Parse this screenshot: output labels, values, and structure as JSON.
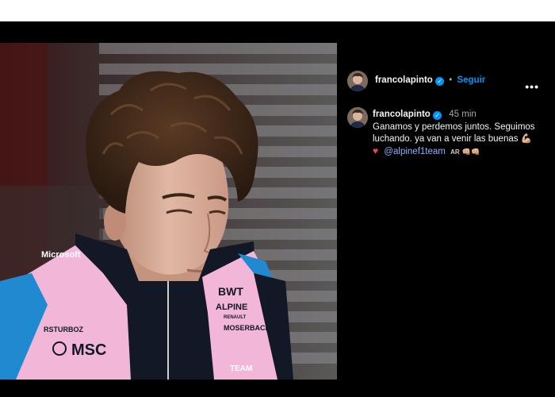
{
  "header": {
    "username": "francolapinto",
    "verified_mark": "✓",
    "separator": "•",
    "follow_label": "Seguir",
    "more_label": "•••"
  },
  "post": {
    "username": "francolapinto",
    "verified_mark": "✓",
    "time": "45 min",
    "caption": "Ganamos y perdemos juntos. Seguimos luchando. ya van a venir las buenas 💪🏼",
    "heart": "♥",
    "mention": "@alpinef1team",
    "flag_code": "AR",
    "fists": "👊🏼👊🏼"
  },
  "photo": {
    "suit_texts": {
      "microsoft": "Microsoft",
      "bwt": "BWT",
      "alpine": "ALPINE",
      "renault": "RENAULT",
      "moserbaer": "MOSERBACH",
      "rsturbo": "RSTURBOZ",
      "msc": "MSC",
      "team": "TEAM"
    },
    "accent_pink": "#f2b6d9",
    "accent_blue": "#1f8ad0",
    "suit_dark": "#121826"
  }
}
